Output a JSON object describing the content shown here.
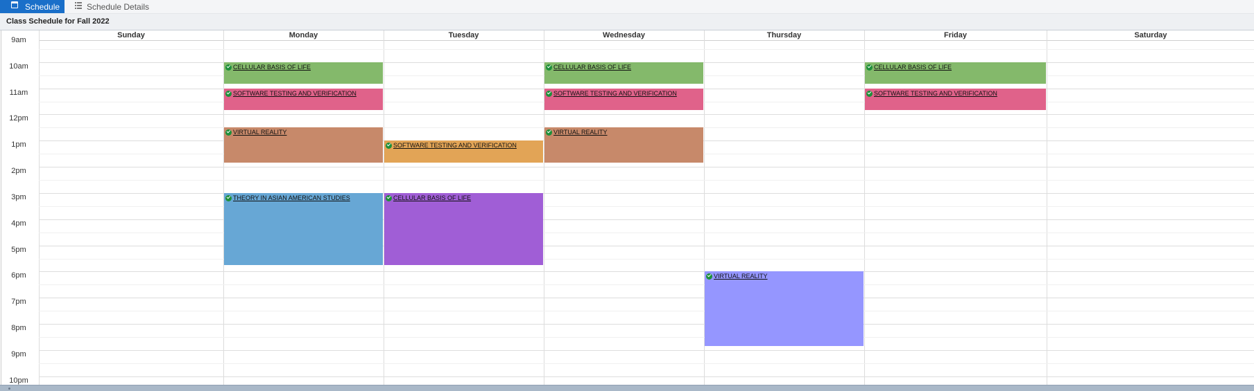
{
  "tabs": [
    {
      "label": "Schedule",
      "active": true,
      "icon": "calendar-icon"
    },
    {
      "label": "Schedule Details",
      "active": false,
      "icon": "list-icon"
    }
  ],
  "header": {
    "title": "Class Schedule for Fall 2022"
  },
  "days": [
    "Sunday",
    "Monday",
    "Tuesday",
    "Wednesday",
    "Thursday",
    "Friday",
    "Saturday"
  ],
  "times": [
    "9am",
    "10am",
    "11am",
    "12pm",
    "1pm",
    "2pm",
    "3pm",
    "4pm",
    "5pm",
    "6pm",
    "7pm",
    "8pm",
    "9pm",
    "10pm"
  ],
  "events": [
    {
      "title": "CELLULAR BASIS OF LIFE",
      "day": "Monday",
      "start": "10:00",
      "end": "10:50",
      "color": "#84b96b"
    },
    {
      "title": "SOFTWARE TESTING AND VERIFICATION",
      "day": "Monday",
      "start": "11:00",
      "end": "11:50",
      "color": "#e0628a"
    },
    {
      "title": "VIRTUAL REALITY",
      "day": "Monday",
      "start": "12:30",
      "end": "13:50",
      "color": "#c7896a"
    },
    {
      "title": "THEORY IN ASIAN AMERICAN STUDIES",
      "day": "Monday",
      "start": "15:00",
      "end": "17:45",
      "color": "#67a7d5"
    },
    {
      "title": "SOFTWARE TESTING AND VERIFICATION",
      "day": "Tuesday",
      "start": "13:00",
      "end": "13:50",
      "color": "#e2a456"
    },
    {
      "title": "CELLULAR BASIS OF LIFE",
      "day": "Tuesday",
      "start": "15:00",
      "end": "17:45",
      "color": "#a05ed6"
    },
    {
      "title": "CELLULAR BASIS OF LIFE",
      "day": "Wednesday",
      "start": "10:00",
      "end": "10:50",
      "color": "#84b96b"
    },
    {
      "title": "SOFTWARE TESTING AND VERIFICATION",
      "day": "Wednesday",
      "start": "11:00",
      "end": "11:50",
      "color": "#e0628a"
    },
    {
      "title": "VIRTUAL REALITY",
      "day": "Wednesday",
      "start": "12:30",
      "end": "13:50",
      "color": "#c7896a"
    },
    {
      "title": "VIRTUAL REALITY",
      "day": "Thursday",
      "start": "18:00",
      "end": "20:50",
      "color": "#9596ff"
    },
    {
      "title": "CELLULAR BASIS OF LIFE",
      "day": "Friday",
      "start": "10:00",
      "end": "10:50",
      "color": "#84b96b"
    },
    {
      "title": "SOFTWARE TESTING AND VERIFICATION",
      "day": "Friday",
      "start": "11:00",
      "end": "11:50",
      "color": "#e0628a"
    }
  ]
}
